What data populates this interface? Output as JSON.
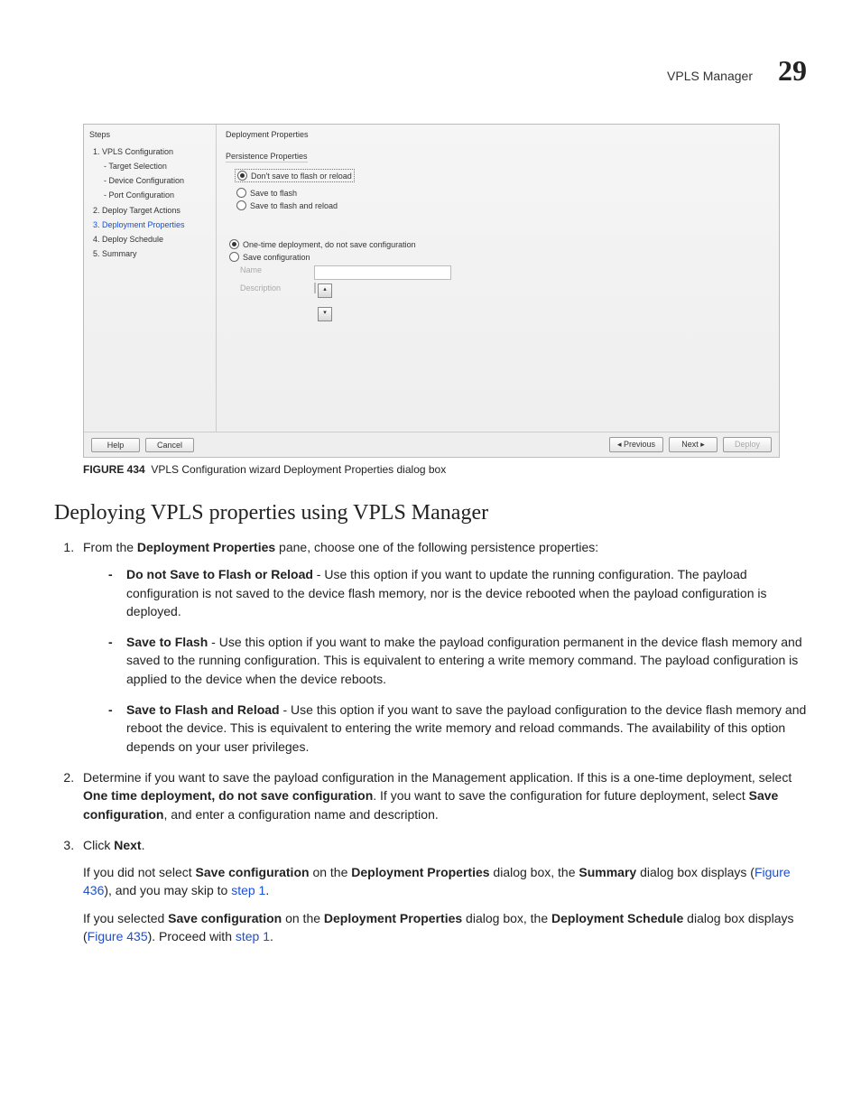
{
  "header": {
    "section": "VPLS Manager",
    "chapter": "29"
  },
  "dialog": {
    "steps_header": "Steps",
    "steps": [
      {
        "label": "1. VPLS Configuration"
      },
      {
        "label": "- Target Selection",
        "sub": true
      },
      {
        "label": "- Device Configuration",
        "sub": true
      },
      {
        "label": "- Port Configuration",
        "sub": true
      },
      {
        "label": "2. Deploy Target Actions"
      },
      {
        "label": "3. Deployment Properties",
        "active": true
      },
      {
        "label": "4. Deploy Schedule"
      },
      {
        "label": "5. Summary"
      }
    ],
    "main_header": "Deployment Properties",
    "persistence_title": "Persistence Properties",
    "persistence_options": {
      "o1": "Don't save to flash or reload",
      "o2": "Save to flash",
      "o3": "Save to flash and reload"
    },
    "save_options": {
      "o1": "One-time deployment, do not save configuration",
      "o2": "Save configuration"
    },
    "name_label": "Name",
    "desc_label": "Description",
    "buttons": {
      "help": "Help",
      "cancel": "Cancel",
      "prev": "◂ Previous",
      "next": "Next ▸",
      "deploy": "Deploy"
    }
  },
  "figure": {
    "label": "FIGURE 434",
    "caption": "VPLS Configuration wizard Deployment Properties dialog box"
  },
  "article": {
    "heading": "Deploying VPLS properties using VPLS Manager",
    "step1_lead": "From the ",
    "step1_bold": "Deployment Properties",
    "step1_tail": " pane, choose one of the following persistence properties:",
    "bullets": {
      "b1_name": "Do not Save to Flash or Reload",
      "b1_text": " - Use this option if you want to update the running configuration. The payload configuration is not saved to the device flash memory, nor is the device rebooted when the payload configuration is deployed.",
      "b2_name": "Save to Flash",
      "b2_text": " - Use this option if you want to make the payload configuration permanent in the device flash memory and saved to the running configuration. This is equivalent to entering a write memory command. The payload configuration is applied to the device when the device reboots.",
      "b3_name": "Save to Flash and Reload",
      "b3_text": " - Use this option if you want to save the payload configuration to the device flash memory and reboot the device. This is equivalent to entering the write memory and reload commands. The availability of this option depends on your user privileges."
    },
    "step2_a": "Determine if you want to save the payload configuration in the Management application. If this is a one-time deployment, select ",
    "step2_b": "One time deployment, do not save configuration",
    "step2_c": ". If you want to save the configuration for future deployment, select ",
    "step2_d": "Save configuration",
    "step2_e": ", and enter a configuration name and description.",
    "step3_a": "Click ",
    "step3_b": "Next",
    "step3_c": ".",
    "p1_a": "If you did not select ",
    "p1_b": "Save configuration",
    "p1_c": " on the ",
    "p1_d": "Deployment Properties",
    "p1_e": " dialog box, the ",
    "p1_f": "Summary",
    "p1_g": " dialog box displays (",
    "p1_link1": "Figure 436",
    "p1_h": "), and you may skip to ",
    "p1_link2": "step 1",
    "p1_i": ".",
    "p2_a": "If you selected ",
    "p2_b": "Save configuration",
    "p2_c": " on the ",
    "p2_d": "Deployment Properties",
    "p2_e": " dialog box, the ",
    "p2_f": "Deployment Schedule",
    "p2_g": " dialog box displays (",
    "p2_link1": "Figure 435",
    "p2_h": "). Proceed with ",
    "p2_link2": "step 1",
    "p2_i": "."
  }
}
